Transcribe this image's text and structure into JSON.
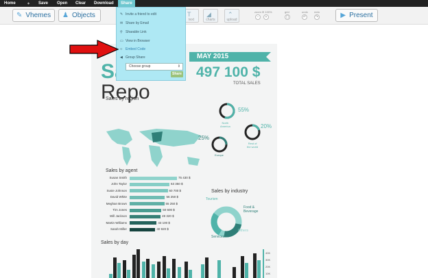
{
  "menubar": {
    "items": [
      {
        "label": "Home"
      },
      {
        "label": "Save"
      },
      {
        "label": "Open"
      },
      {
        "label": "Clear"
      },
      {
        "label": "Download"
      },
      {
        "label": "Share"
      }
    ]
  },
  "toolbar": {
    "themes_label": "Vhemes",
    "objects_label": "Objects",
    "text_tool_label": "text",
    "charts_tool_label": "charts",
    "upload_tool_label": "upload",
    "zoom_label": "zoom ⊕ 100%",
    "grid_label": "grid",
    "undo_label": "undo",
    "redo_label": "redo",
    "present_label": "Present"
  },
  "share_menu": {
    "items": [
      {
        "label": "Invite a friend to edit",
        "icon": "pencil-icon"
      },
      {
        "label": "Share by Email",
        "icon": "email-icon"
      },
      {
        "label": "Sharable Link",
        "icon": "link-icon"
      },
      {
        "label": "View in Browser",
        "icon": "browser-icon"
      },
      {
        "label": "Embed Code",
        "icon": "code-icon"
      },
      {
        "label": "Group Share",
        "icon": "group-icon"
      }
    ],
    "select_value": "Choose group",
    "share_button": "Share"
  },
  "infographic": {
    "title_line1": "Sa",
    "title_line2": "Repo",
    "month": "MAY 2015",
    "total_value": "497 100 $",
    "total_label": "TOTAL SALES",
    "region_heading": "Sales by region",
    "regions": [
      {
        "name": "North America",
        "label": "North\nAmerica",
        "percent": 55
      },
      {
        "name": "Rest of the world",
        "label": "Rest of\nthe world",
        "percent": 20
      },
      {
        "name": "Europe",
        "label": "Europe",
        "percent": 25
      }
    ],
    "agent_heading": "Sales by agent",
    "industry_heading": "Sales by industry",
    "industry_labels": [
      "Tourism",
      "Food &\nBeverage",
      "Services",
      "Others"
    ],
    "day_heading": "Sales by day",
    "day_axis_labels": [
      "40K",
      "30K",
      "20K",
      "10K"
    ]
  },
  "chart_data": {
    "type": "bar",
    "title": "Sales by agent",
    "categories": [
      "Susan Smith",
      "John Taylor",
      "Susie Johnson",
      "David White",
      "Meghan Brown",
      "Tim Jones",
      "Will Jackson",
      "Martin Williams",
      "Sarah Miller"
    ],
    "values": [
      75430,
      63350,
      60700,
      56250,
      55250,
      50600,
      49320,
      43100,
      40920
    ],
    "value_labels": [
      "75 430 $",
      "63 350 $",
      "60 700 $",
      "56 250 $",
      "55 250 $",
      "50 600 $",
      "49 320 $",
      "43 100 $",
      "40 920 $"
    ]
  },
  "colors": {
    "teal": "#4fb3a9",
    "teal_light": "#8fd3cc",
    "dark": "#222222",
    "share_panel": "#aee8f4",
    "arrow": "#e01010"
  }
}
